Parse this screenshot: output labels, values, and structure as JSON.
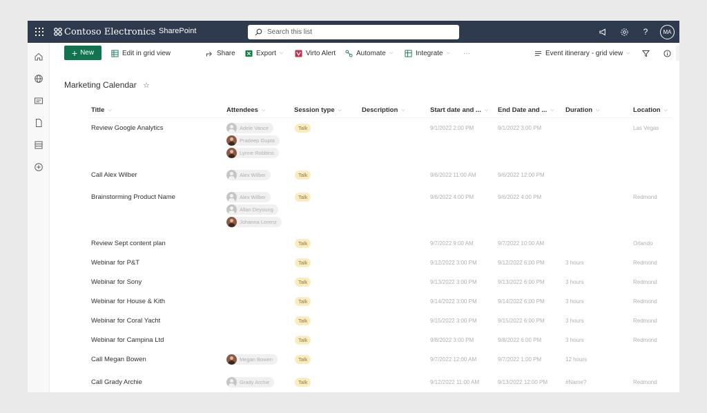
{
  "suite": {
    "brand": "Contoso Electronics",
    "app": "SharePoint",
    "search_placeholder": "Search this list",
    "user_initials": "MA"
  },
  "commands": {
    "new": "New",
    "edit_grid": "Edit in grid view",
    "share": "Share",
    "export": "Export",
    "virto_alert": "Virto Alert",
    "automate": "Automate",
    "integrate": "Integrate",
    "more": "···",
    "view": "Event itinerary - grid view"
  },
  "page": {
    "title": "Marketing Calendar"
  },
  "columns": [
    "Title",
    "Attendees",
    "Session type",
    "Description",
    "Start date and ...",
    "End Date and ...",
    "Duration",
    "Location"
  ],
  "rows": [
    {
      "title": "Review Google Analytics",
      "attendees": [
        {
          "name": "Adele Vance",
          "photo": false
        },
        {
          "name": "Pradeep Gupta",
          "photo": true
        },
        {
          "name": "Lynne Robbins",
          "photo": true
        }
      ],
      "session": "Talk",
      "start": "9/1/2022 2:00 PM",
      "end": "9/1/2022 3:00 PM",
      "duration": "",
      "location": "Las Vegas"
    },
    {
      "title": "Call Alex Wilber",
      "attendees": [
        {
          "name": "Alex Wilber",
          "photo": false
        }
      ],
      "session": "Talk",
      "start": "9/6/2022 11:00 AM",
      "end": "9/6/2022 12:00 PM",
      "duration": "",
      "location": ""
    },
    {
      "title": "Brainstorming Product Name",
      "attendees": [
        {
          "name": "Alex Wilber",
          "photo": false
        },
        {
          "name": "Allan Deyoung",
          "photo": false
        },
        {
          "name": "Johanna Lorenz",
          "photo": true
        }
      ],
      "session": "Talk",
      "start": "9/6/2022 4:00 PM",
      "end": "9/6/2022 4:00 PM",
      "duration": "",
      "location": "Redmond"
    },
    {
      "title": "Review Sept content plan",
      "attendees": [],
      "session": "Talk",
      "start": "9/7/2022 9:00 AM",
      "end": "9/7/2022 10:00 AM",
      "duration": "",
      "location": "Orlando"
    },
    {
      "title": "Webinar for P&T",
      "attendees": [],
      "session": "Talk",
      "start": "9/12/2022 3:00 PM",
      "end": "9/12/2022 6:00 PM",
      "duration": "3 hours",
      "location": "Redmond"
    },
    {
      "title": "Webinar for Sony",
      "attendees": [],
      "session": "Talk",
      "start": "9/13/2022 3:00 PM",
      "end": "9/13/2022 6:00 PM",
      "duration": "3 hours",
      "location": "Redmond"
    },
    {
      "title": "Webinar for House & Kith",
      "attendees": [],
      "session": "Talk",
      "start": "9/14/2022 3:00 PM",
      "end": "9/14/2022 6:00 PM",
      "duration": "3 hours",
      "location": "Redmond"
    },
    {
      "title": "Webinar for Coral Yacht",
      "attendees": [],
      "session": "Talk",
      "start": "9/15/2022 3:00 PM",
      "end": "9/15/2022 6:00 PM",
      "duration": "3 hours",
      "location": "Redmond"
    },
    {
      "title": "Webinar for Campina Ltd",
      "attendees": [],
      "session": "Talk",
      "start": "9/8/2022 3:00 PM",
      "end": "9/8/2022 6:00 PM",
      "duration": "3 hours",
      "location": "Redmond"
    },
    {
      "title": "Call Megan Bowen",
      "attendees": [
        {
          "name": "Megan Bowen",
          "photo": true
        }
      ],
      "session": "Talk",
      "start": "9/7/2022 12:00 AM",
      "end": "9/7/2022 1:00 PM",
      "duration": "12 hours",
      "location": ""
    },
    {
      "title": "Call Grady Archie",
      "attendees": [
        {
          "name": "Grady Archie",
          "photo": false
        }
      ],
      "session": "Talk",
      "start": "9/12/2022 11:00 AM",
      "end": "9/13/2022 12:00 PM",
      "duration": "#Name?",
      "location": "Redmond"
    }
  ]
}
